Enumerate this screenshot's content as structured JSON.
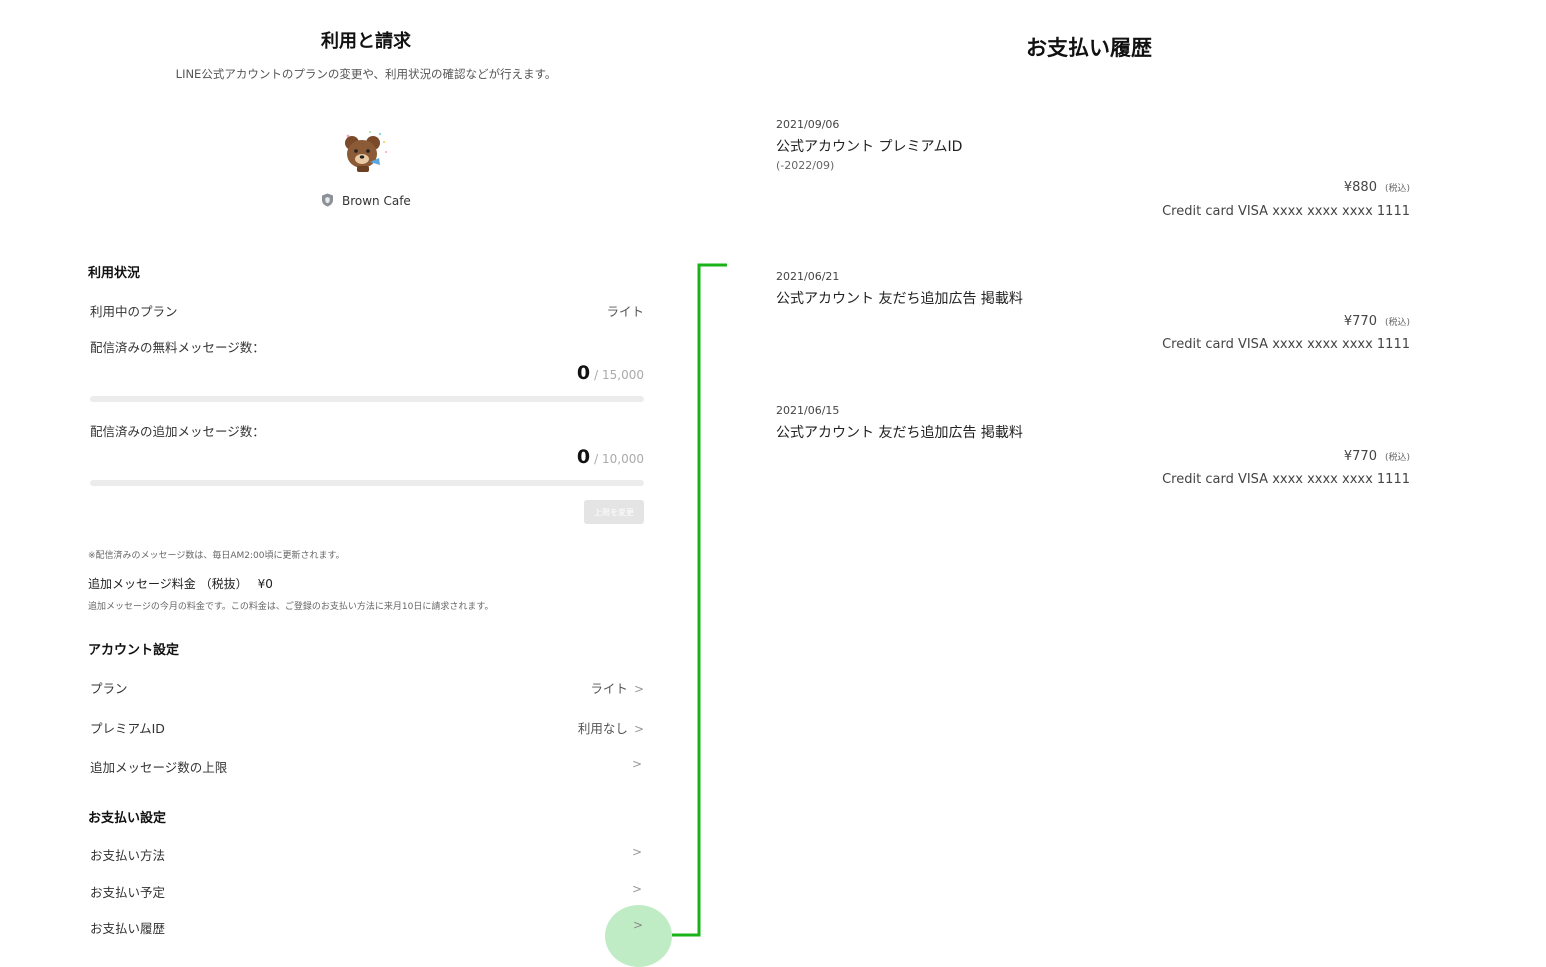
{
  "billing": {
    "title": "利用と請求",
    "description": "LINE公式アカウントのプランの変更や、利用状況の確認などが行えます。",
    "account_name": "Brown Cafe",
    "usage": {
      "section_title": "利用状況",
      "plan_label": "利用中のプラン",
      "plan_value": "ライト",
      "free_messages_label": "配信済みの無料メッセージ数：",
      "free_messages_count": "0",
      "free_messages_limit": "/ 15,000",
      "free_messages_progress": 0,
      "additional_messages_label": "配信済みの追加メッセージ数：",
      "additional_messages_count": "0",
      "additional_messages_limit": "/ 10,000",
      "additional_messages_progress": 0,
      "change_limit_button": "上限を変更",
      "update_note": "※配信済みのメッセージ数は、毎日AM2:00頃に更新されます。",
      "fee_label": "追加メッセージ料金 （税抜）",
      "fee_value": "¥0",
      "fee_note": "追加メッセージの今月の料金です。この料金は、ご登録のお支払い方法に来月10日に請求されます。"
    },
    "account_settings": {
      "section_title": "アカウント設定",
      "plan_label": "プラン",
      "plan_value": "ライト",
      "premium_id_label": "プレミアムID",
      "premium_id_value": "利用なし",
      "message_limit_label": "追加メッセージ数の上限"
    },
    "payment_settings": {
      "section_title": "お支払い設定",
      "method_label": "お支払い方法",
      "schedule_label": "お支払い予定",
      "history_label": "お支払い履歴"
    }
  },
  "history": {
    "title": "お支払い履歴",
    "entries": [
      {
        "date": "2021/09/06",
        "item": "公式アカウント プレミアムID",
        "period": "(-2022/09)",
        "price": "¥880",
        "tax": "(税込)",
        "card": "Credit card VISA xxxx xxxx xxxx 1111"
      },
      {
        "date": "2021/06/21",
        "item": "公式アカウント 友だち追加広告 掲載料",
        "period": "",
        "price": "¥770",
        "tax": "(税込)",
        "card": "Credit card VISA xxxx xxxx xxxx 1111"
      },
      {
        "date": "2021/06/15",
        "item": "公式アカウント 友だち追加広告 掲載料",
        "period": "",
        "price": "¥770",
        "tax": "(税込)",
        "card": "Credit card VISA xxxx xxxx xxxx 1111"
      }
    ]
  },
  "colors": {
    "accent": "#06c755",
    "connector": "#19b219",
    "highlight": "#bfecc4"
  }
}
